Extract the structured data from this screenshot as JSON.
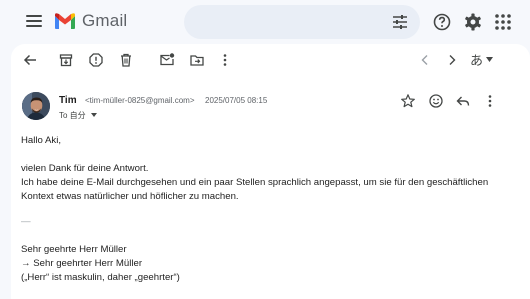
{
  "app": {
    "name": "Gmail",
    "accent_colors": {
      "red": "#ea4335",
      "blue": "#4285f4",
      "green": "#34a853",
      "yellow": "#fbbc04"
    }
  },
  "header": {
    "menu_icon": "hamburger-icon",
    "search_options_icon": "tune-icon",
    "right_icons": [
      "help-icon",
      "settings-icon",
      "apps-grid-icon"
    ]
  },
  "toolbar": {
    "left_icons": [
      "back-arrow-icon",
      "archive-icon",
      "report-spam-icon",
      "delete-icon",
      "mark-unread-icon",
      "move-to-icon",
      "more-vert-icon"
    ],
    "right_icons": [
      "newer-chevron-icon",
      "older-chevron-icon",
      "input-tools-icon"
    ],
    "input_tools_label": "あ"
  },
  "message": {
    "sender_name": "Tim",
    "sender_email": "<tim-müller-0825@gmail.com>",
    "date": "2025/07/05 08:15",
    "to_label": "To 自分",
    "action_icons": [
      "star-icon",
      "emoji-icon",
      "reply-icon",
      "more-vert-icon"
    ],
    "body": {
      "greeting": "Hallo Aki,",
      "line1": "vielen Dank für deine Antwort.",
      "line2": "Ich habe deine E-Mail durchgesehen und ein paar Stellen sprachlich angepasst, um sie für den geschäftlichen",
      "line3": "Kontext etwas natürlicher und höflicher zu machen.",
      "separator": "—",
      "line4": "Sehr geehrte Herr Müller",
      "line5": "→ Sehr geehrter Herr Müller",
      "line6": "(„Herr“ ist maskulin, daher „geehrter“)"
    }
  }
}
